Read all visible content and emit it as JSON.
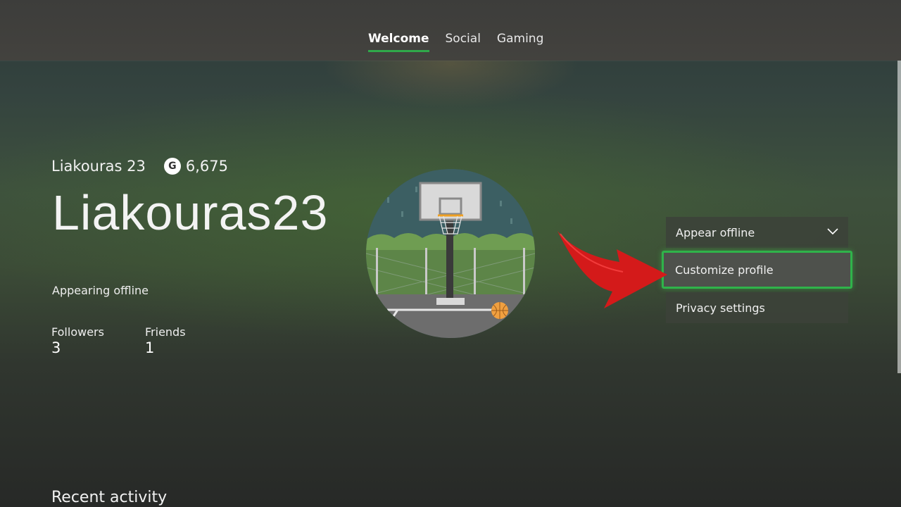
{
  "tabs": [
    {
      "label": "Welcome",
      "active": true
    },
    {
      "label": "Social",
      "active": false
    },
    {
      "label": "Gaming",
      "active": false
    }
  ],
  "profile": {
    "gamertag_small": "Liakouras 23",
    "gamerscore_icon": "G",
    "gamerscore": "6,675",
    "gamertag_large": "Liakouras23",
    "status": "Appearing offline",
    "followers_label": "Followers",
    "followers_count": "3",
    "friends_label": "Friends",
    "friends_count": "1"
  },
  "menu": {
    "appear_offline": "Appear offline",
    "customize_profile": "Customize profile",
    "privacy_settings": "Privacy settings"
  },
  "recent_activity": "Recent activity",
  "colors": {
    "accent": "#2fb34a",
    "annotation_arrow": "#d11616"
  }
}
